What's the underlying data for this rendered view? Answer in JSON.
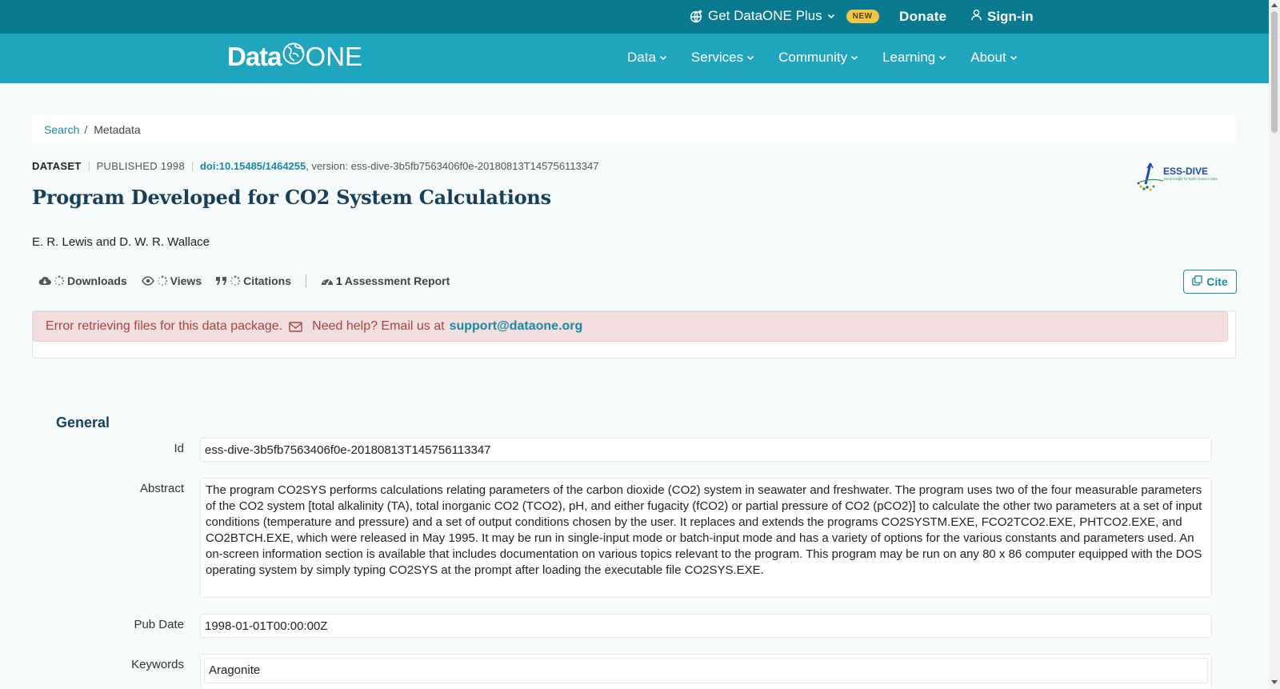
{
  "topbar": {
    "plus_label": "Get DataONE Plus",
    "new_badge": "NEW",
    "donate": "Donate",
    "signin": "Sign-in"
  },
  "brand": {
    "logo_data": "Data",
    "logo_one": "ONE"
  },
  "nav": [
    "Data",
    "Services",
    "Community",
    "Learning",
    "About"
  ],
  "breadcrumb": {
    "search": "Search",
    "separator": "/",
    "current": "Metadata"
  },
  "meta": {
    "type": "DATASET",
    "published": "PUBLISHED 1998",
    "doi": "doi:10.15485/1464255",
    "version": ", version: ess-dive-3b5fb7563406f0e-20180813T145756113347"
  },
  "repository_logo": {
    "name": "ESS-DIVE",
    "tagline": "Deep Insight for Earth Science Data"
  },
  "title": "Program Developed for CO2 System Calculations",
  "authors": "E. R. Lewis and D. W. R. Wallace",
  "metrics": {
    "downloads": "Downloads",
    "views": "Views",
    "citations": "Citations",
    "assessment_count": "1",
    "assessment_label": "Assessment Report"
  },
  "cite_label": "Cite",
  "alert": {
    "message": "Error retrieving files for this data package.",
    "help": "Need help? Email us at",
    "email": "support@dataone.org"
  },
  "general": {
    "heading": "General",
    "id_label": "Id",
    "id_value": "ess-dive-3b5fb7563406f0e-20180813T145756113347",
    "abstract_label": "Abstract",
    "abstract_value": "The program CO2SYS performs calculations relating parameters of the carbon dioxide (CO2) system in seawater and freshwater. The program uses two of the four measurable parameters of the CO2 system [total alkalinity (TA), total inorganic CO2 (TCO2), pH, and either fugacity (fCO2) or partial pressure of CO2 (pCO2)] to calculate the other two parameters at a set of input conditions (temperature and pressure) and a set of output conditions chosen by the user. It replaces and extends the programs CO2SYSTM.EXE, FCO2TCO2.EXE, PHTCO2.EXE, and CO2BTCH.EXE, which were released in May 1995. It may be run in single-input mode or batch-input mode and has a variety of options for the various constants and parameters used. An on-screen information section is available that includes documentation on various topics relevant to the program. This program may be run on any 80 x 86 computer equipped with the DOS operating system by simply typing CO2SYS at the prompt after loading the executable file CO2SYS.EXE.",
    "pubdate_label": "Pub Date",
    "pubdate_value": "1998-01-01T00:00:00Z",
    "keywords_label": "Keywords",
    "keywords": [
      "Aragonite"
    ]
  },
  "colors": {
    "topbar": "#0a7a91",
    "navbar": "#1fa5bd",
    "link": "#1a8aa3",
    "heading": "#173f5a",
    "alert_bg": "#f2dede",
    "alert_text": "#a94442",
    "badge": "#f1c644"
  }
}
